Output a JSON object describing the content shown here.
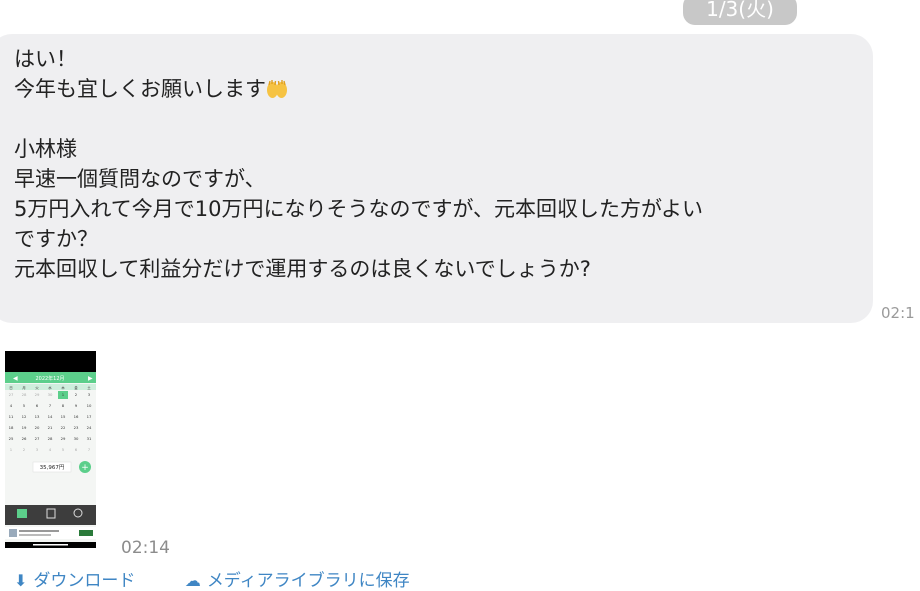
{
  "date_label": "1/3(火)",
  "message": {
    "lines": [
      "はい！",
      "今年も宜しくお願いします",
      "",
      "小林様",
      "早速一個質問なのですが、",
      "5万円入れて今月で10万円になりそうなのですが、元本回収した方がよい",
      "ですか？",
      "元本回収して利益分だけで運用するのは良くないでしょうか?"
    ],
    "emoji": "raising-hands-emoji",
    "time": "02:1"
  },
  "attachment": {
    "time": "02:14",
    "screenshot": {
      "month_label": "2022年12月",
      "weekdays": [
        "日",
        "月",
        "火",
        "水",
        "木",
        "金",
        "土"
      ],
      "weeks": [
        [
          "27",
          "28",
          "29",
          "30",
          "1",
          "2",
          "3"
        ],
        [
          "4",
          "5",
          "6",
          "7",
          "8",
          "9",
          "10"
        ],
        [
          "11",
          "12",
          "13",
          "14",
          "15",
          "16",
          "17"
        ],
        [
          "18",
          "19",
          "20",
          "21",
          "22",
          "23",
          "24"
        ],
        [
          "25",
          "26",
          "27",
          "28",
          "29",
          "30",
          "31"
        ],
        [
          "1",
          "2",
          "3",
          "4",
          "5",
          "6",
          "7"
        ]
      ],
      "total": "35,967円"
    }
  },
  "actions": {
    "download": "ダウンロード",
    "save_media": "メディアライブラリに保存"
  },
  "colors": {
    "bubble_bg": "#efeff1",
    "pill_bg": "#c8c8c8",
    "accent_green": "#5ccf8b",
    "link_blue": "#3f86c4"
  }
}
